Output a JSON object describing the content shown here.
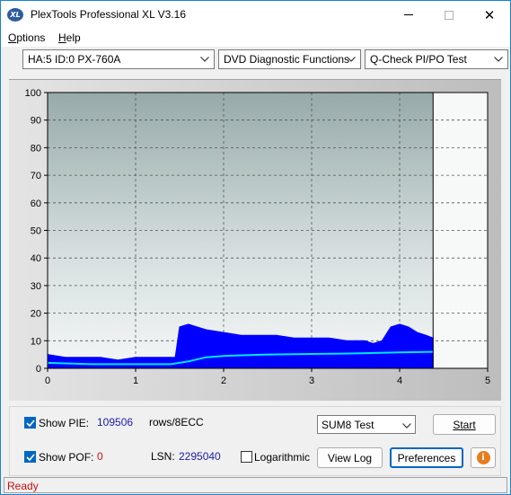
{
  "window": {
    "title": "PlexTools Professional XL V3.16",
    "icon_text": "XL"
  },
  "menu": {
    "options_prefix": "O",
    "options_rest": "ptions",
    "help_prefix": "H",
    "help_rest": "elp"
  },
  "toolbar": {
    "drive": "HA:5 ID:0  PX-760A",
    "function": "DVD Diagnostic Functions",
    "test": "Q-Check PI/PO Test"
  },
  "chart_data": {
    "type": "area",
    "title": "",
    "xlabel": "",
    "ylabel": "",
    "xlim": [
      0,
      5
    ],
    "ylim": [
      0,
      100
    ],
    "x_ticks": [
      0,
      1,
      2,
      3,
      4,
      5
    ],
    "y_ticks": [
      0,
      10,
      20,
      30,
      40,
      50,
      60,
      70,
      80,
      90,
      100
    ],
    "grid": true,
    "data_end_x": 4.38,
    "series": [
      {
        "color": "#0000ff",
        "x": [
          0,
          0.2,
          0.4,
          0.6,
          0.8,
          1.0,
          1.2,
          1.4,
          1.45,
          1.5,
          1.6,
          1.8,
          2.0,
          2.2,
          2.4,
          2.6,
          2.8,
          3.0,
          3.2,
          3.4,
          3.6,
          3.7,
          3.8,
          3.9,
          4.0,
          4.1,
          4.2,
          4.3,
          4.38
        ],
        "values": [
          5,
          4,
          4,
          4,
          3,
          4,
          4,
          4,
          4,
          15,
          16,
          14,
          13,
          12,
          12,
          12,
          11,
          11,
          11,
          10,
          10,
          9,
          10,
          15,
          16,
          15,
          13,
          12,
          11
        ]
      },
      {
        "color": "#00e5ff",
        "x": [
          0,
          0.5,
          1.0,
          1.4,
          1.6,
          1.8,
          2.0,
          2.5,
          3.0,
          3.5,
          4.0,
          4.38
        ],
        "values": [
          2,
          1.5,
          1.5,
          1.5,
          2.5,
          4,
          4.5,
          5,
          5.2,
          5.4,
          5.8,
          6
        ]
      }
    ]
  },
  "controls": {
    "show_pie_label": "Show PIE:",
    "pie_value": "109506",
    "pie_unit": "rows/8ECC",
    "show_pof_label": "Show POF:",
    "pof_value": "0",
    "lsn_label": "LSN:",
    "lsn_value": "2295040",
    "log_label": "Logarithmic",
    "sum8_select": "SUM8 Test",
    "start_button": "Start",
    "view_log_button": "View Log",
    "preferences_button": "Preferences",
    "info_icon": "i",
    "show_pie_checked": true,
    "show_pof_checked": true,
    "logarithmic_checked": false
  },
  "status": {
    "text": "Ready"
  }
}
